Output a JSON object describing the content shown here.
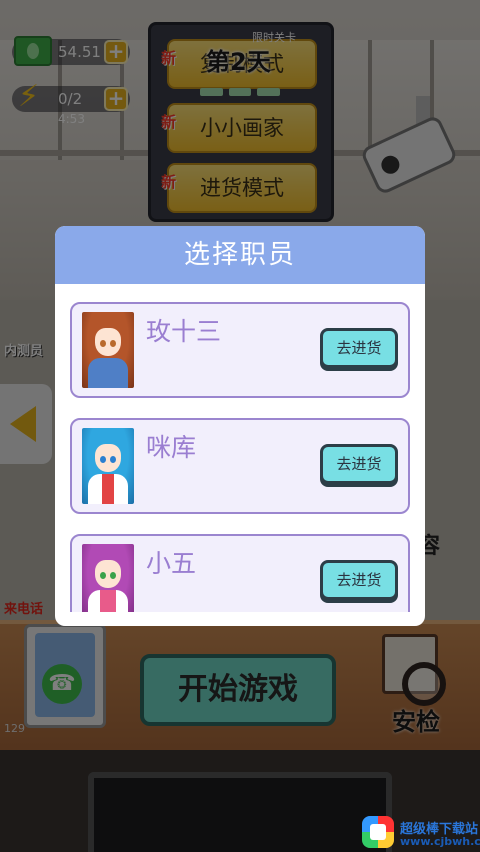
{
  "hud": {
    "money": "54.51",
    "energy": "0/2",
    "energy_timer": "4:53",
    "plus_label": "+"
  },
  "day": {
    "label": "第2天",
    "timing_label": "限时关卡"
  },
  "mode_menu": {
    "new_tag": "新",
    "items": [
      {
        "label": "复制模式"
      },
      {
        "label": "小小画家"
      },
      {
        "label": "进货模式"
      }
    ]
  },
  "background": {
    "inner_test_label": "内测员",
    "call_label": "来电话",
    "right_text": "容",
    "page_number": "129",
    "phone_icon": "☎",
    "start_game_label": "开始游戏",
    "security_check_label": "安检"
  },
  "modal": {
    "title": "选择职员",
    "employees": [
      {
        "name": "玫十三",
        "button_label": "去进货",
        "hair_color": "#b4552a",
        "outfit_color": "#4f7fc6"
      },
      {
        "name": "咪库",
        "button_label": "去进货",
        "hair_color": "#2fa7e0",
        "outfit_color": "#e24444"
      },
      {
        "name": "小五",
        "button_label": "去进货",
        "hair_color": "#b14ab5",
        "outfit_color": "#e85b8a"
      }
    ]
  },
  "watermark": {
    "title": "超级棒下载站",
    "url": "www.cjbwh.com"
  },
  "colors": {
    "modal_header": "#8aa9ea",
    "card_border": "#9b86cf",
    "name_color": "#9a7ed1",
    "go_button": "#78dfe4",
    "mode_button": "#f3bf2c",
    "start_button": "#6fd7c4"
  }
}
